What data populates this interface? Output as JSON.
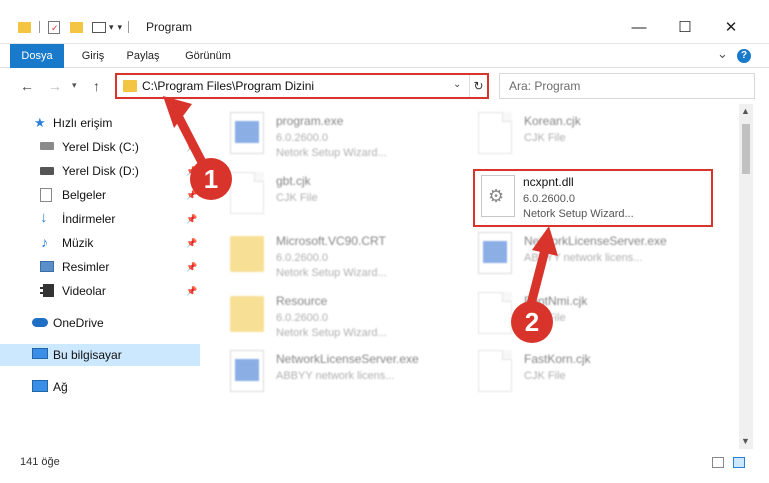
{
  "window": {
    "title": "Program",
    "minimize_glyph": "—",
    "maximize_glyph": "☐",
    "close_glyph": "✕"
  },
  "ribbon": {
    "tabs": [
      "Dosya",
      "Giriş",
      "Paylaş",
      "Görünüm"
    ],
    "collapse_glyph": "⌄",
    "help_glyph": "?"
  },
  "address": {
    "path": "C:\\Program Files\\Program Dizini",
    "search_placeholder": "Ara: Program"
  },
  "sidebar": {
    "items": [
      {
        "label": "Hızlı erişim",
        "icon": "star-icon",
        "pinned": false
      },
      {
        "label": "Yerel Disk (C:)",
        "icon": "drive-icon",
        "pinned": true
      },
      {
        "label": "Yerel Disk (D:)",
        "icon": "drive-icon",
        "pinned": true
      },
      {
        "label": "Belgeler",
        "icon": "documents-icon",
        "pinned": true
      },
      {
        "label": "İndirmeler",
        "icon": "download-icon",
        "pinned": true
      },
      {
        "label": "Müzik",
        "icon": "music-icon",
        "pinned": true
      },
      {
        "label": "Resimler",
        "icon": "pictures-icon",
        "pinned": true
      },
      {
        "label": "Videolar",
        "icon": "videos-icon",
        "pinned": true
      },
      {
        "label": "OneDrive",
        "icon": "cloud-icon",
        "pinned": false
      },
      {
        "label": "Bu bilgisayar",
        "icon": "computer-icon",
        "pinned": false
      },
      {
        "label": "Ağ",
        "icon": "network-icon",
        "pinned": false
      }
    ]
  },
  "files": [
    {
      "name": "program.exe",
      "line1": "6.0.2600.0",
      "line2": "Netork Setup Wizard...",
      "icon": "exe-icon"
    },
    {
      "name": "Korean.cjk",
      "line1": "CJK File",
      "line2": "",
      "icon": "document-icon"
    },
    {
      "name": "gbt.cjk",
      "line1": "CJK File",
      "line2": "",
      "icon": "document-icon"
    },
    {
      "name": "ncxpnt.dll",
      "line1": "6.0.2600.0",
      "line2": "Netork Setup Wizard...",
      "icon": "gear-file-icon"
    },
    {
      "name": "Microsoft.VC90.CRT",
      "line1": "6.0.2600.0",
      "line2": "Netork Setup Wizard...",
      "icon": "folder-icon"
    },
    {
      "name": "NetworkLicenseServer.exe",
      "line1": "ABBYY network licens...",
      "line2": "",
      "icon": "exe-icon"
    },
    {
      "name": "Resource",
      "line1": "6.0.2600.0",
      "line2": "Netork Setup Wizard...",
      "icon": "folder-icon"
    },
    {
      "name": "FontNmi.cjk",
      "line1": "CJK File",
      "line2": "",
      "icon": "document-icon"
    },
    {
      "name": "NetworkLicenseServer.exe",
      "line1": "ABBYY network licens...",
      "line2": "",
      "icon": "exe-icon"
    },
    {
      "name": "FastKorn.cjk",
      "line1": "CJK File",
      "line2": "",
      "icon": "document-icon"
    }
  ],
  "status": {
    "count": "141 öğe"
  },
  "annotations": {
    "badge1": "1",
    "badge2": "2",
    "accent_color": "#d9342b"
  }
}
